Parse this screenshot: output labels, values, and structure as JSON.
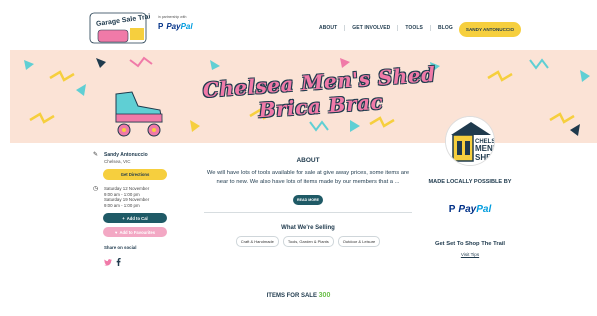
{
  "header": {
    "logo_text": "Garage Sale Trail",
    "partner_label": "in partnership with",
    "partner_name_1": "Pay",
    "partner_name_2": "Pal",
    "nav": [
      "ABOUT",
      "GET INVOLVED",
      "TOOLS",
      "BLOG"
    ],
    "signin_label": "SANDY ANTONUCCIO"
  },
  "banner": {
    "title": "Chelsea Men's Shed Brica Brac"
  },
  "sidebar": {
    "owner_name": "Sandy Antonuccio",
    "owner_location": "Chelsea, VIC",
    "directions_label": "Get Directions",
    "dates": [
      "Saturday 12 November",
      "9:00 am - 1:00 pm",
      "Saturday 19 November",
      "9:00 am - 1:00 pm"
    ],
    "add_cal_label": "Add to Cal",
    "add_fav_label": "Add to Favourites",
    "share_label": "Share on social"
  },
  "about": {
    "title": "ABOUT",
    "text": "We will have lots of tools available for sale at give away prices, some items are near to new. We also have lots of items made by our members that a ...",
    "read_more_label": "READ MORE"
  },
  "selling": {
    "title": "What We're Selling",
    "tags": [
      "Craft & Handmade",
      "Tools, Garden & Plants",
      "Outdoor & Leisure"
    ]
  },
  "items": {
    "label": "ITEMS FOR SALE",
    "count": "300"
  },
  "right": {
    "shed_logo_text": "CHELSEA MEN'S SHED",
    "made_local_label": "MADE LOCALLY POSSIBLE BY",
    "sponsor_1": "Pay",
    "sponsor_2": "Pal",
    "trail_title": "Get Set To Shop The Trail",
    "visit_tips_label": "Visit Tips"
  },
  "colors": {
    "accent_yellow": "#f6cf3e",
    "teal": "#1f5a66",
    "pink": "#f3a8c4",
    "banner_bg": "#fbe3d6",
    "text": "#1f3a4d"
  }
}
